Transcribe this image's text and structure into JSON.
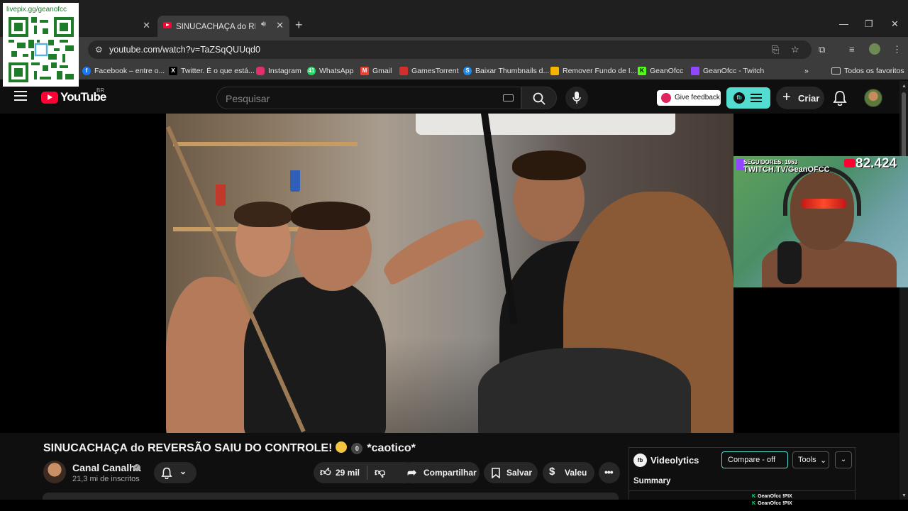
{
  "qr": {
    "caption": "livepix.gg/geanofcc"
  },
  "browser": {
    "tabs": [
      {
        "title": "SINUCACHAÇA do REVERSÃO SAIU DO CONTROLE! 😂 ⓪ *caotico*",
        "active": true
      }
    ],
    "url": "youtube.com/watch?v=TaZSqQUUqd0",
    "bookmarks": [
      {
        "label": "Facebook – entre o...",
        "icon": "facebook-icon",
        "color": "#1877f2"
      },
      {
        "label": "Twitter. É o que está...",
        "icon": "x-icon",
        "color": "#000000"
      },
      {
        "label": "Instagram",
        "icon": "instagram-icon",
        "color": "#e1306c"
      },
      {
        "label": "WhatsApp",
        "icon": "whatsapp-icon",
        "color": "#25d366"
      },
      {
        "label": "Gmail",
        "icon": "gmail-icon",
        "color": "#ea4335"
      },
      {
        "label": "GamesTorrent",
        "icon": "gamestorrent-icon",
        "color": "#d32f2f"
      },
      {
        "label": "Baixar Thumbnails d...",
        "icon": "thumbnails-icon",
        "color": "#1e88e5"
      },
      {
        "label": "Remover Fundo de I...",
        "icon": "removebg-icon",
        "color": "#f4b400"
      },
      {
        "label": "GeanOfcc",
        "icon": "kick-icon",
        "color": "#53fc18"
      },
      {
        "label": "GeanOfcc - Twitch",
        "icon": "twitch-icon",
        "color": "#9146ff"
      }
    ],
    "all_bookmarks": "Todos os favoritos"
  },
  "youtube": {
    "logo_text": "YouTube",
    "country": "BR",
    "search_placeholder": "Pesquisar",
    "feedback_label": "Give feedback",
    "create_label": "Criar"
  },
  "stream_overlay": {
    "followers": "SEGUIDORES: 1963",
    "channel": "TWITCH.TV/GeanOFCC",
    "viewer_count": "82.424"
  },
  "video": {
    "title": "SINUCACHAÇA do REVERSÃO SAIU DO CONTROLE!",
    "title_suffix_badge": "0",
    "title_suffix": "*caotico*",
    "channel_name": "Canal Canalha",
    "subscribers": "21,3 mi de inscritos",
    "likes": "29 mil",
    "share_label": "Compartilhar",
    "save_label": "Salvar",
    "thanks_label": "Valeu"
  },
  "videolytics": {
    "title": "Videolytics",
    "compare_label": "Compare - off",
    "tools_label": "Tools",
    "summary_label": "Summary"
  },
  "chat_notices": [
    {
      "user": "GeanOfcc",
      "text": "!PIX"
    },
    {
      "user": "GeanOfcc",
      "text": "!PIX"
    }
  ]
}
